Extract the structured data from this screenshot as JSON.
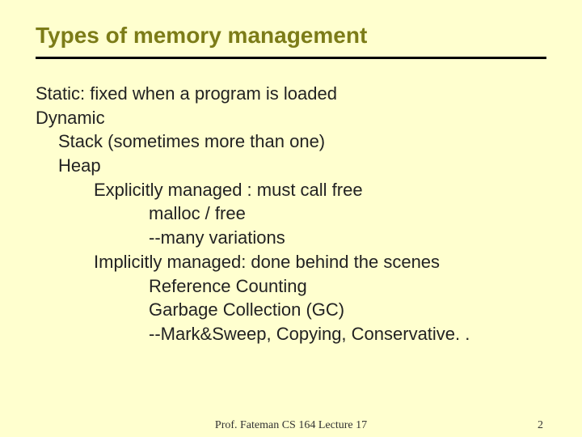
{
  "title": "Types of memory management",
  "lines": {
    "static": "Static: fixed when a program is loaded",
    "dynamic": "Dynamic",
    "stack": "Stack (sometimes more than one)",
    "heap": "Heap",
    "explicit": "Explicitly managed : must call free",
    "malloc": "malloc / free",
    "variations": "--many variations",
    "implicit": "Implicitly managed: done behind the scenes",
    "refcount": "Reference Counting",
    "gc": "Garbage Collection (GC)",
    "marksweep": "--Mark&Sweep, Copying, Conservative. ."
  },
  "footer": {
    "center": "Prof. Fateman CS 164  Lecture 17",
    "pageno": "2"
  }
}
